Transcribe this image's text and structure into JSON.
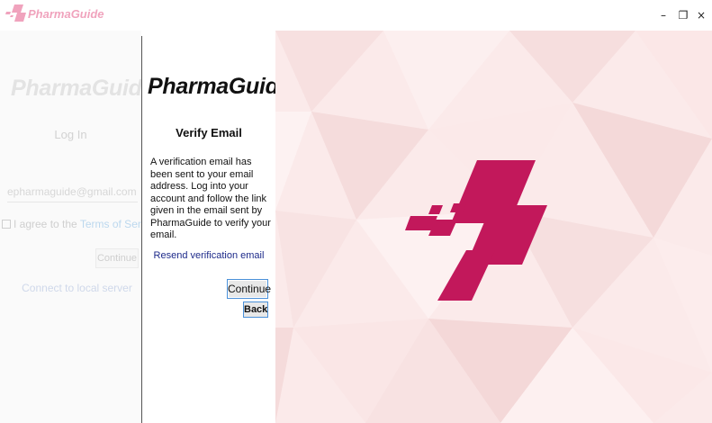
{
  "window": {
    "title": "PharmaGuide",
    "logo_icon": "pharmaguide-logo-icon",
    "controls": {
      "minimize": "–",
      "maximize": "❐",
      "close": "×"
    }
  },
  "login": {
    "brand": "PharmaGuide",
    "heading": "Log In",
    "email_value": "epharmaguide@gmail.com",
    "agree_prefix": "I agree to the ",
    "terms_link": "Terms of Service",
    "continue_label": "Continue",
    "local_server_link": "Connect to local server"
  },
  "verify": {
    "brand": "PharmaGuide",
    "title": "Verify Email",
    "message": "A verification email has been sent to your email address. Log into your account and follow the link given in the email sent by PharmaGuide to verify your email.",
    "resend_link": "Resend verification email",
    "continue_label": "Continue",
    "back_label": "Back"
  },
  "colors": {
    "brand": "#c2185b",
    "brand_light": "#f0a3bd",
    "link": "#1d2a8a",
    "button_border": "#4a90d9"
  }
}
